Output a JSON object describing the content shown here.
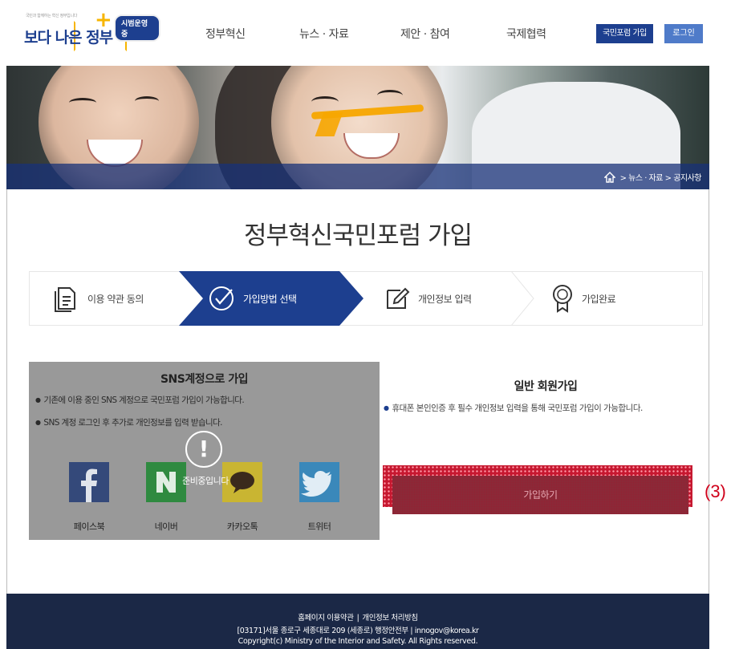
{
  "header": {
    "logo": {
      "tagline": "국민과 함께하는 혁신 정부입니다",
      "main": "보다 나은 정부",
      "badge": "시범운영중"
    },
    "nav": [
      "정부혁신",
      "뉴스 · 자료",
      "제안 · 참여",
      "국제협력"
    ],
    "join_label": "국민포럼 가입",
    "login_label": "로그인"
  },
  "breadcrumb": "> 뉴스 · 자료 > 공지사항",
  "page_title": "정부혁신국민포럼 가입",
  "steps": [
    {
      "label": "이용 약관 동의",
      "icon": "document-icon",
      "active": false
    },
    {
      "label": "가입방법 선택",
      "icon": "check-circle-icon",
      "active": true
    },
    {
      "label": "개인정보 입력",
      "icon": "pencil-icon",
      "active": false
    },
    {
      "label": "가입완료",
      "icon": "award-icon",
      "active": false
    }
  ],
  "sns": {
    "title": "SNS계정으로 가입",
    "items": [
      "기존에 이용 중인 SNS 계정으로 국민포럼 가입이 가능합니다.",
      "SNS 계정 로그인 후 추가로 개인정보를 입력 받습니다."
    ],
    "overlay_text": "준비중입니다",
    "providers": [
      {
        "label": "페이스북",
        "icon": "facebook-icon"
      },
      {
        "label": "네이버",
        "icon": "naver-icon"
      },
      {
        "label": "카카오톡",
        "icon": "kakaotalk-icon"
      },
      {
        "label": "트위터",
        "icon": "twitter-icon"
      }
    ]
  },
  "general": {
    "title": "일반 회원가입",
    "description": "휴대폰 본인인증 후 필수 개인정보 입력을 통해 국민포럼 가입이 가능합니다.",
    "join_button": "가입하기"
  },
  "annotation": "(3)",
  "footer": {
    "terms": "홈페이지 이용약관",
    "privacy": "개인정보 처리방침",
    "address": "[03171]서울 종로구 세종대로 209 (세종로) 행정안전부 | innogov@korea.kr",
    "copyright": "Copyright(c) Ministry of the Interior and Safety. All Rights reserved."
  },
  "colors": {
    "brand": "#1d3f8f",
    "accent": "#f7b500",
    "highlight": "#c61830",
    "footer": "#1b2846"
  }
}
